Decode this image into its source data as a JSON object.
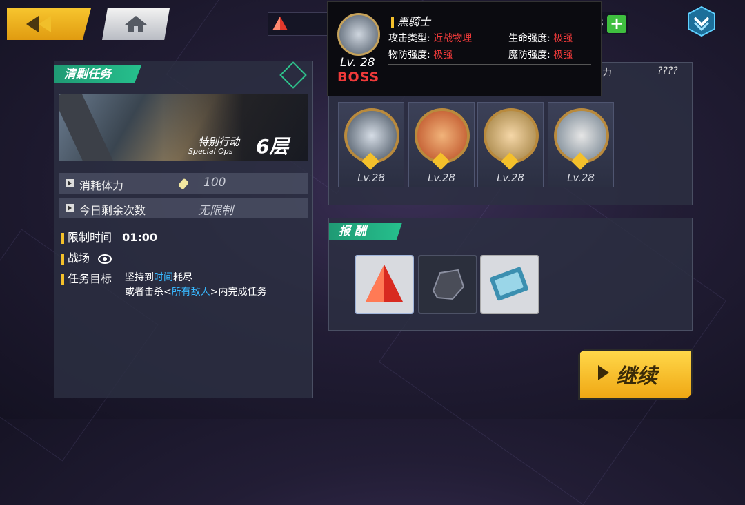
{
  "topbar": {
    "back_icon": "chevron-left-icon",
    "home_icon": "home-icon",
    "crystal_icon": "red-crystal-icon",
    "stamina_value_tail": "8",
    "plus_label": "+",
    "menu_icon": "chevron-down-shield-icon"
  },
  "boss_popup": {
    "name": "黑骑士",
    "level": "Lv. 28",
    "boss_label": "BOSS",
    "attack_type_label": "攻击类型:",
    "attack_type_value": "近战物理",
    "hp_label": "生命强度:",
    "hp_value": "极强",
    "phys_def_label": "物防强度:",
    "phys_def_value": "极强",
    "mag_def_label": "魔防强度:",
    "mag_def_value": "极强"
  },
  "mission": {
    "tag": "清剿任务",
    "op_cn": "特别行动",
    "op_en": "Special Ops",
    "floor": "6层",
    "stamina_label": "消耗体力",
    "stamina_cost": "100",
    "remaining_label": "今日剩余次数",
    "remaining_value": "无限制",
    "time_label": "限制时间",
    "time_value": "01:00",
    "field_label": "战场",
    "goal_label": "任务目标",
    "goal_line1_a": "坚持到",
    "goal_line1_b": "时间",
    "goal_line1_c": "耗尽",
    "goal_line2_a": "或者击杀<",
    "goal_line2_b": "所有敌人",
    "goal_line2_c": ">内完成任务"
  },
  "enemies": {
    "header_right_partial": "力",
    "header_right_value": "????",
    "list": [
      {
        "level": "Lv.28"
      },
      {
        "level": "Lv.28"
      },
      {
        "level": "Lv.28"
      },
      {
        "level": "Lv.28"
      }
    ]
  },
  "rewards": {
    "tag": "报 酬",
    "items": [
      "red-crystal-icon",
      "ore-icon",
      "ticket-icon"
    ]
  },
  "continue_label": "继续",
  "colors": {
    "accent_green": "#26c08d",
    "gold": "#f4c02b",
    "danger_red": "#f03a3a",
    "highlight_blue": "#38b8ff"
  }
}
